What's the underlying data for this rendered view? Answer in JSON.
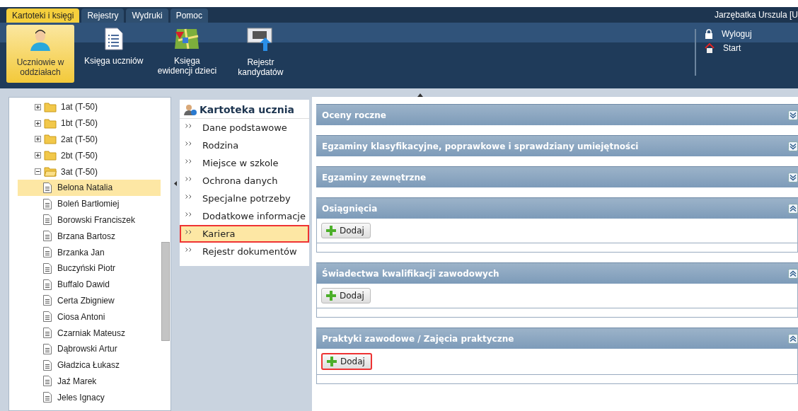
{
  "menu_tabs": [
    {
      "label": "Kartoteki i księgi",
      "selected": true
    },
    {
      "label": "Rejestry",
      "selected": false
    },
    {
      "label": "Wydruki",
      "selected": false
    },
    {
      "label": "Pomoc",
      "selected": false
    }
  ],
  "user": "Jarzębatka Urszula [U",
  "toolbar": [
    {
      "label": "Uczniowie w oddziałach",
      "kind": "person",
      "selected": true
    },
    {
      "label": "Księga uczniów",
      "kind": "document",
      "selected": false
    },
    {
      "label": "Księga ewidencji dzieci",
      "kind": "map",
      "selected": false
    },
    {
      "label": "Rejestr kandydatów",
      "kind": "register",
      "selected": false
    }
  ],
  "session_links": [
    {
      "label": "Wyloguj",
      "kind": "lock"
    },
    {
      "label": "Start",
      "kind": "home"
    }
  ],
  "tree": [
    {
      "label": "1at (T-50)",
      "expanded": false
    },
    {
      "label": "1bt (T-50)",
      "expanded": false
    },
    {
      "label": "2at (T-50)",
      "expanded": false
    },
    {
      "label": "2bt (T-50)",
      "expanded": false
    },
    {
      "label": "3at (T-50)",
      "expanded": true,
      "children": [
        {
          "label": "Belona Natalia",
          "selected": true
        },
        {
          "label": "Boleń Bartłomiej",
          "selected": false
        },
        {
          "label": "Borowski Franciszek",
          "selected": false
        },
        {
          "label": "Brzana Bartosz",
          "selected": false
        },
        {
          "label": "Brzanka Jan",
          "selected": false
        },
        {
          "label": "Buczyński Piotr",
          "selected": false
        },
        {
          "label": "Buffalo Dawid",
          "selected": false
        },
        {
          "label": "Certa Zbigniew",
          "selected": false
        },
        {
          "label": "Ciosa Antoni",
          "selected": false
        },
        {
          "label": "Czarniak Mateusz",
          "selected": false
        },
        {
          "label": "Dąbrowski Artur",
          "selected": false
        },
        {
          "label": "Gładzica Łukasz",
          "selected": false
        },
        {
          "label": "Jaź Marek",
          "selected": false
        },
        {
          "label": "Jeles Ignacy",
          "selected": false
        }
      ]
    }
  ],
  "record_menu": {
    "title": "Kartoteka ucznia",
    "items": [
      {
        "label": "Dane podstawowe",
        "selected": false,
        "highlighted": false
      },
      {
        "label": "Rodzina",
        "selected": false,
        "highlighted": false
      },
      {
        "label": "Miejsce w szkole",
        "selected": false,
        "highlighted": false
      },
      {
        "label": "Ochrona danych",
        "selected": false,
        "highlighted": false
      },
      {
        "label": "Specjalne potrzeby",
        "selected": false,
        "highlighted": false
      },
      {
        "label": "Dodatkowe informacje",
        "selected": false,
        "highlighted": false
      },
      {
        "label": "Kariera",
        "selected": true,
        "highlighted": true
      },
      {
        "label": "Rejestr dokumentów",
        "selected": false,
        "highlighted": false
      }
    ]
  },
  "sections": [
    {
      "title": "Oceny roczne",
      "expanded": false
    },
    {
      "title": "Egzaminy klasyfikacyjne, poprawkowe i sprawdziany umiejętności",
      "expanded": false
    },
    {
      "title": "Egzaminy zewnętrzne",
      "expanded": false
    },
    {
      "title": "Osiągnięcia",
      "expanded": true,
      "button": {
        "label": "Dodaj",
        "highlighted": false
      }
    },
    {
      "title": "Świadectwa kwalifikacji zawodowych",
      "expanded": true,
      "button": {
        "label": "Dodaj",
        "highlighted": false
      }
    },
    {
      "title": "Praktyki zawodowe / Zajęcia praktyczne",
      "expanded": true,
      "button": {
        "label": "Dodaj",
        "highlighted": true
      }
    }
  ]
}
